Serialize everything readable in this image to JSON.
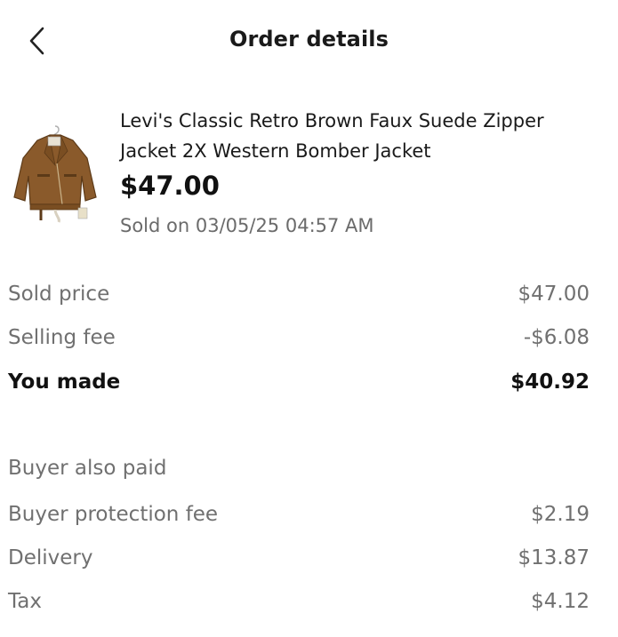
{
  "header": {
    "title": "Order details"
  },
  "product": {
    "name": "Levi's Classic Retro Brown Faux Suede Zipper Jacket 2X Western Bomber Jacket",
    "price": "$47.00",
    "sold_on": "Sold on 03/05/25 04:57 AM",
    "thumbnail_icon": "jacket-image"
  },
  "earnings": [
    {
      "label": "Sold price",
      "value": "$47.00"
    },
    {
      "label": "Selling fee",
      "value": "-$6.08"
    },
    {
      "label": "You made",
      "value": "$40.92"
    }
  ],
  "buyer_section": {
    "heading": "Buyer also paid",
    "items": [
      {
        "label": "Buyer protection fee",
        "value": "$2.19"
      },
      {
        "label": "Delivery",
        "value": "$13.87"
      },
      {
        "label": "Tax",
        "value": "$4.12"
      }
    ]
  },
  "colors": {
    "text_primary": "#111111",
    "text_secondary": "#707070",
    "jacket_brown": "#8a5a2b"
  }
}
